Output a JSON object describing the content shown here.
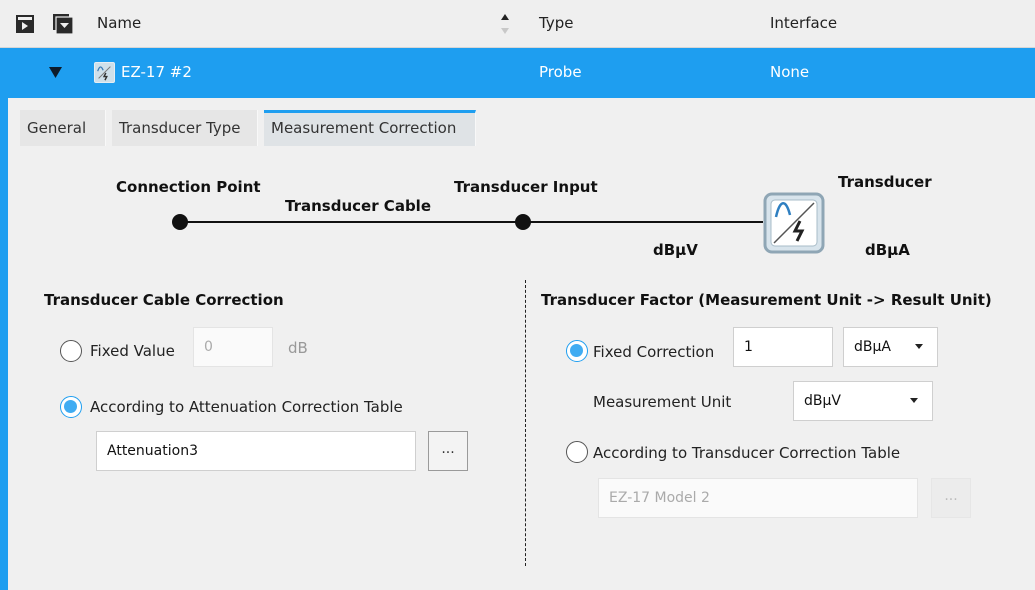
{
  "header": {
    "columns": {
      "name": "Name",
      "type": "Type",
      "interface": "Interface"
    },
    "icons": [
      "collapse-all-icon",
      "expand-all-icon",
      "sort-icon"
    ]
  },
  "row": {
    "name": "EZ-17 #2",
    "type": "Probe",
    "interface": "None",
    "icon": "transducer-device-icon",
    "highlight_color": "#1e9ef0"
  },
  "tabs": [
    {
      "label": "General"
    },
    {
      "label": "Transducer Type"
    },
    {
      "label": "Measurement Correction",
      "active": true
    }
  ],
  "diagram": {
    "connection_point": "Connection Point",
    "cable": "Transducer Cable",
    "input": "Transducer Input",
    "transducer": "Transducer",
    "input_unit": "dBµV",
    "output_unit": "dBµA"
  },
  "cable_correction": {
    "title": "Transducer Cable Correction",
    "fixed_label": "Fixed Value",
    "fixed_value": "0",
    "fixed_unit": "dB",
    "table_label": "According to Attenuation Correction Table",
    "table_value": "Attenuation3",
    "browse_label": "...",
    "selected": "table"
  },
  "factor": {
    "title": "Transducer Factor (Measurement Unit -> Result Unit)",
    "fixed_label": "Fixed Correction",
    "fixed_value": "1",
    "result_unit": "dBµA",
    "measurement_unit_label": "Measurement Unit",
    "measurement_unit": "dBµV",
    "table_label": "According to Transducer Correction Table",
    "table_value": "EZ-17 Model 2",
    "browse_label": "...",
    "selected": "fixed"
  },
  "colors": {
    "accent": "#1e9ef0",
    "panel": "#f0f0f0"
  }
}
